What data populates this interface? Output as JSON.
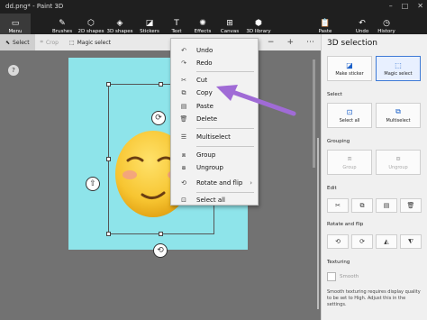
{
  "window": {
    "title": "dd.png* - Paint 3D"
  },
  "ribbon": {
    "menu": "Menu",
    "items": [
      "Brushes",
      "2D shapes",
      "3D shapes",
      "Stickers",
      "Text",
      "Effects",
      "Canvas",
      "3D library"
    ],
    "paste": "Paste",
    "undo": "Undo",
    "history": "History"
  },
  "toolbar": {
    "select": "Select",
    "crop": "Crop",
    "magic_select": "Magic select"
  },
  "context_menu": {
    "items": [
      "Undo",
      "Redo",
      "Cut",
      "Copy",
      "Paste",
      "Delete",
      "Multiselect",
      "Group",
      "Ungroup",
      "Rotate and flip",
      "Select all"
    ]
  },
  "panel": {
    "title": "3D selection",
    "make_sticker": "Make sticker",
    "magic_select": "Magic select",
    "select_heading": "Select",
    "select_all": "Select all",
    "multiselect": "Multiselect",
    "grouping_heading": "Grouping",
    "group": "Group",
    "ungroup": "Ungroup",
    "edit_heading": "Edit",
    "rotate_heading": "Rotate and flip",
    "texturing_heading": "Texturing",
    "smooth": "Smooth",
    "smooth_desc": "Smooth texturing requires display quality to be set to High. Adjust this in the settings."
  },
  "colors": {
    "accent": "#1a5fc8",
    "annotation": "#a06bd6",
    "canvas": "#8ee4ea"
  }
}
